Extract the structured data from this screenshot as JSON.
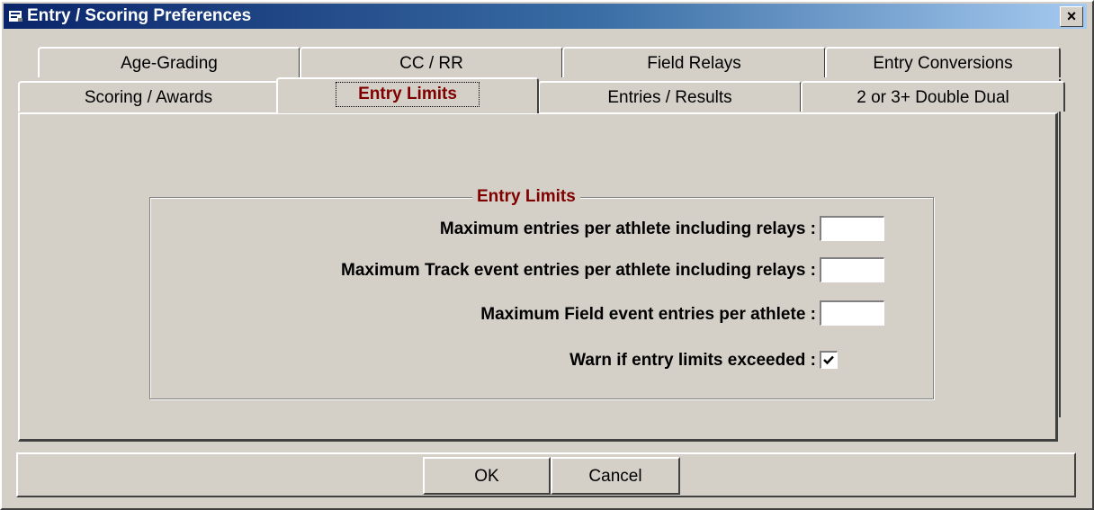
{
  "window": {
    "title": "Entry / Scoring Preferences",
    "close_label": "×"
  },
  "tabs_back": [
    {
      "label": "Age-Grading"
    },
    {
      "label": "CC / RR"
    },
    {
      "label": "Field Relays"
    },
    {
      "label": "Entry Conversions"
    }
  ],
  "tabs_front": [
    {
      "label": "Scoring / Awards"
    },
    {
      "label": "Entry Limits",
      "active": true
    },
    {
      "label": "Entries / Results"
    },
    {
      "label": "2 or 3+ Double Dual"
    }
  ],
  "group": {
    "title": "Entry Limits",
    "fields": [
      {
        "label": "Maximum entries per athlete including relays :",
        "value": ""
      },
      {
        "label": "Maximum Track event entries per athlete including relays :",
        "value": ""
      },
      {
        "label": "Maximum Field event entries per athlete :",
        "value": ""
      }
    ],
    "warn_label": "Warn if entry limits exceeded :",
    "warn_checked": true
  },
  "buttons": {
    "ok": "OK",
    "cancel": "Cancel"
  },
  "colors": {
    "active_tab_text": "#800000",
    "title_gradient_start": "#0a246a",
    "title_gradient_end": "#a6caf0",
    "face": "#d4d0c8"
  }
}
